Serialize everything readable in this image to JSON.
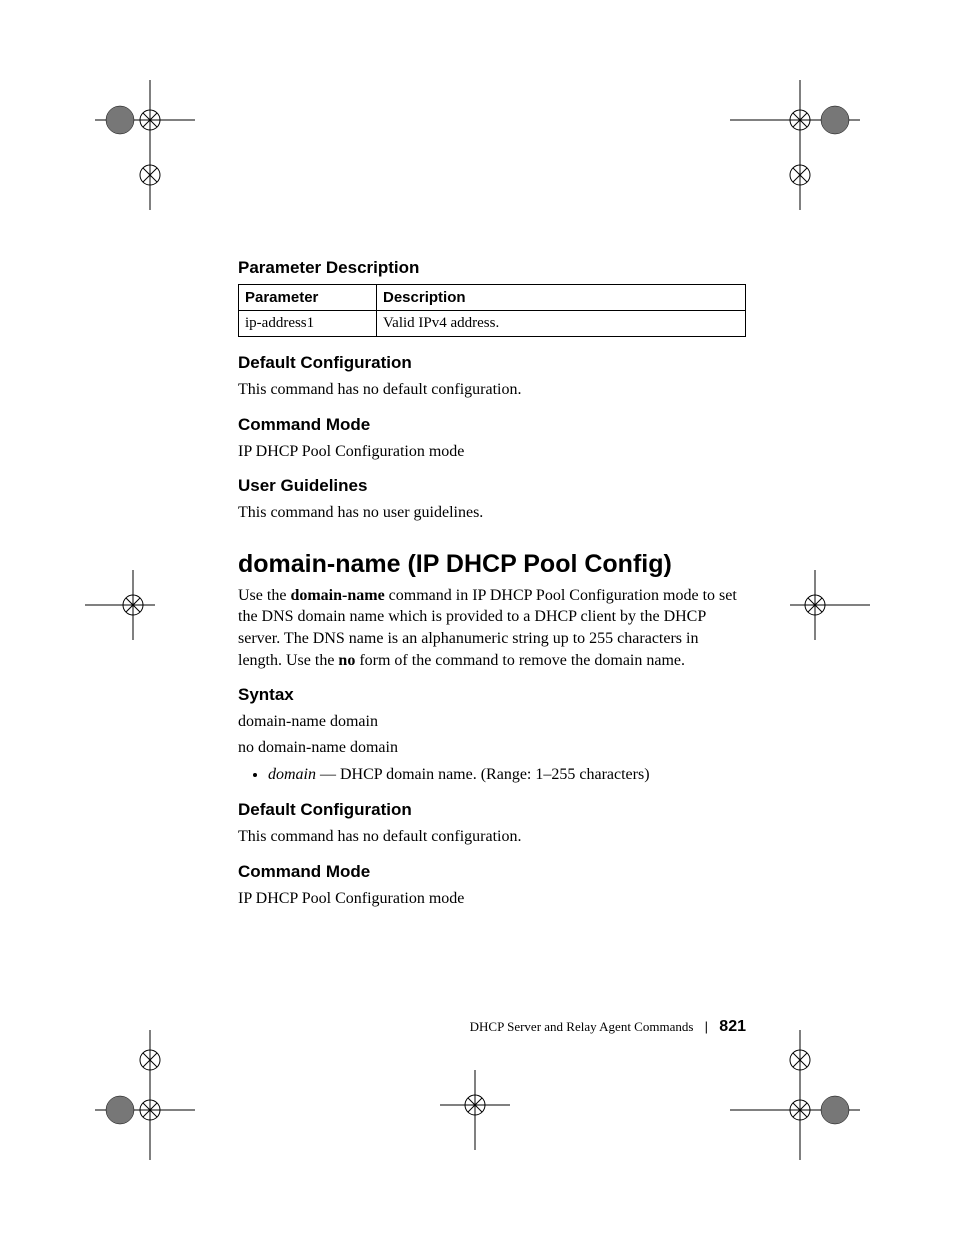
{
  "section1": {
    "heading": "Parameter Description",
    "table": {
      "headers": [
        "Parameter",
        "Description"
      ],
      "rows": [
        {
          "param": "ip-address1",
          "desc": "Valid IPv4 address."
        }
      ]
    }
  },
  "section2": {
    "heading": "Default Configuration",
    "text": "This command has no default configuration."
  },
  "section3": {
    "heading": "Command Mode",
    "text": " IP DHCP Pool Configuration mode"
  },
  "section4": {
    "heading": "User Guidelines",
    "text": "This command has no user guidelines."
  },
  "command": {
    "title": "domain-name (IP DHCP Pool Config)",
    "intro_pre": "Use the ",
    "intro_bold1": "domain-name",
    "intro_mid": " command in IP DHCP Pool Configuration mode to set the DNS domain name which is provided to a DHCP client by the DHCP server. The DNS name is an alphanumeric string up to 255 characters in length. Use the ",
    "intro_bold2": "no",
    "intro_post": " form of the command to remove the domain name."
  },
  "syntax": {
    "heading": "Syntax",
    "line1_bold": "domain-name",
    "line1_ital": " domain",
    "line2_bold": "no domain-name",
    "line2_ital": " domain",
    "bullet_ital": "domain",
    "bullet_rest": " — DHCP domain name. (Range: 1–255 characters)"
  },
  "section5": {
    "heading": "Default Configuration",
    "text": "This command has no default configuration."
  },
  "section6": {
    "heading": "Command Mode",
    "text": " IP DHCP Pool Configuration mode"
  },
  "footer": {
    "chapter": "DHCP Server and Relay Agent Commands",
    "page": "821"
  }
}
